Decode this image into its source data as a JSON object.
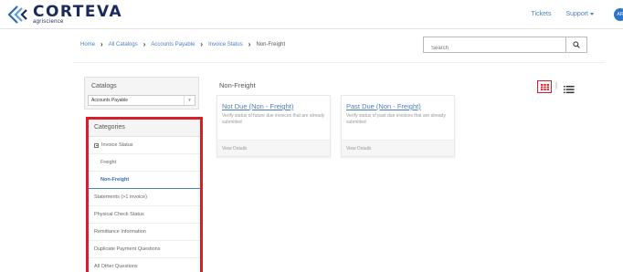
{
  "brand": {
    "name": "CORTEVA",
    "tagline": "agriscience",
    "primary_color": "#1b2a5c",
    "accent_color": "#4a7fc1",
    "highlight_color": "#d91e2b"
  },
  "header": {
    "links": [
      {
        "label": "Tickets"
      },
      {
        "label": "Support"
      }
    ],
    "support_has_dropdown": true,
    "avatar_label": "AR"
  },
  "breadcrumb": {
    "items": [
      "Home",
      "All Catalogs",
      "Accounts Payable",
      "Invoice Status"
    ],
    "current": "Non-Freight"
  },
  "search": {
    "placeholder": "Search",
    "value": "",
    "icon": "search-icon"
  },
  "sidebar": {
    "catalogs_heading": "Catalogs",
    "catalog_selected": "Accounts Payable",
    "categories_heading": "Categories",
    "items": [
      {
        "label": "Invoice Status",
        "expanded": true
      },
      {
        "label": "Freight",
        "sub": true
      },
      {
        "label": "Non-Freight",
        "sub": true,
        "active": true
      },
      {
        "label": "Statements (>1 invoice)"
      },
      {
        "label": "Physical Check Status"
      },
      {
        "label": "Remittance Information"
      },
      {
        "label": "Duplicate Payment Questions"
      },
      {
        "label": "All Other Questions"
      }
    ]
  },
  "content": {
    "title": "Non-Freight",
    "cards": [
      {
        "title": "Not Due (Non - Freight)",
        "description": "Verify status of future due invoices that are already submitted",
        "footer": "View Details"
      },
      {
        "title": "Past Due (Non - Freight)",
        "description": "Verify status of past due invoices that are already submitted",
        "footer": "View Details"
      }
    ],
    "view_mode": "grid",
    "view_icons": [
      "grid-view-icon",
      "list-view-icon"
    ]
  }
}
